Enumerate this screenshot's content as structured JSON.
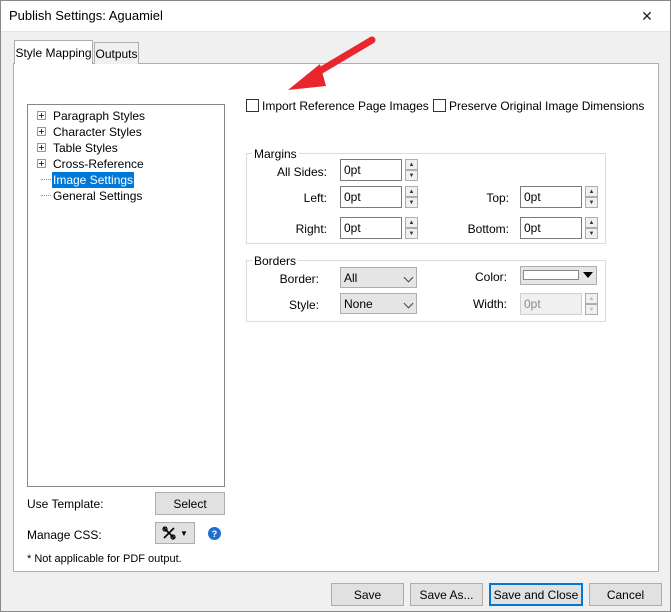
{
  "window": {
    "title": "Publish Settings: Aguamiel",
    "close_glyph": "✕"
  },
  "tabs": [
    {
      "label": "Style Mapping",
      "active": true
    },
    {
      "label": "Outputs",
      "active": false
    }
  ],
  "tree": {
    "items": [
      {
        "label": "Paragraph Styles",
        "expandable": true,
        "selected": false
      },
      {
        "label": "Character Styles",
        "expandable": true,
        "selected": false
      },
      {
        "label": "Table Styles",
        "expandable": true,
        "selected": false
      },
      {
        "label": "Cross-Reference",
        "expandable": true,
        "selected": false
      },
      {
        "label": "Image Settings",
        "expandable": false,
        "selected": true
      },
      {
        "label": "General Settings",
        "expandable": false,
        "selected": false
      }
    ]
  },
  "options": {
    "import_reference": {
      "label": "Import Reference Page Images",
      "checked": false
    },
    "preserve_dimensions": {
      "label": "Preserve Original Image Dimensions",
      "checked": false
    }
  },
  "margins": {
    "title": "Margins",
    "all_sides": {
      "label": "All Sides:",
      "value": "0pt"
    },
    "left": {
      "label": "Left:",
      "value": "0pt"
    },
    "top": {
      "label": "Top:",
      "value": "0pt"
    },
    "right": {
      "label": "Right:",
      "value": "0pt"
    },
    "bottom": {
      "label": "Bottom:",
      "value": "0pt"
    }
  },
  "borders": {
    "title": "Borders",
    "border": {
      "label": "Border:",
      "value": "All"
    },
    "style": {
      "label": "Style:",
      "value": "None"
    },
    "color": {
      "label": "Color:",
      "value": "#ffffff"
    },
    "width": {
      "label": "Width:",
      "value": "0pt",
      "disabled": true
    }
  },
  "template": {
    "label": "Use Template:",
    "button": "Select"
  },
  "css": {
    "label": "Manage CSS:",
    "help_glyph": "?"
  },
  "note": "* Not applicable for PDF output.",
  "footer": {
    "save": "Save",
    "save_as": "Save As...",
    "save_close": "Save and Close",
    "cancel": "Cancel"
  },
  "annotation": {
    "arrow_color": "#e8262b"
  },
  "colors": {
    "selection": "#0078d7",
    "help": "#1e6fd1"
  }
}
